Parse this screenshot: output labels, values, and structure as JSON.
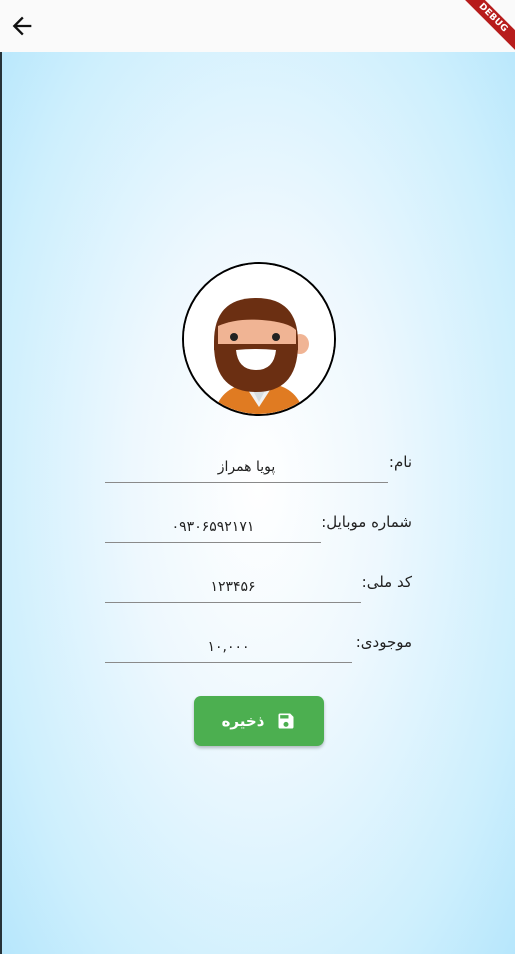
{
  "appbar": {
    "back_icon": "arrow-left-icon"
  },
  "debug_banner": {
    "label": "DEBUG"
  },
  "avatar": {
    "icon": "bearded-man-avatar-icon"
  },
  "form": {
    "name_label": "نام:",
    "name_value": "پویا همراز",
    "mobile_label": "شماره موبایل:",
    "mobile_value": "۰۹۳۰۶۵۹۲۱۷۱",
    "national_id_label": "کد ملی:",
    "national_id_value": "۱۲۳۴۵۶",
    "balance_label": "موجودی:",
    "balance_value": "۱۰,۰۰۰"
  },
  "save_button": {
    "label": "ذخیره",
    "icon": "floppy-disk-icon"
  },
  "colors": {
    "accent_green": "#4caf50",
    "background_blue": "#b3e5fc",
    "debug_red": "#b71c1c"
  }
}
